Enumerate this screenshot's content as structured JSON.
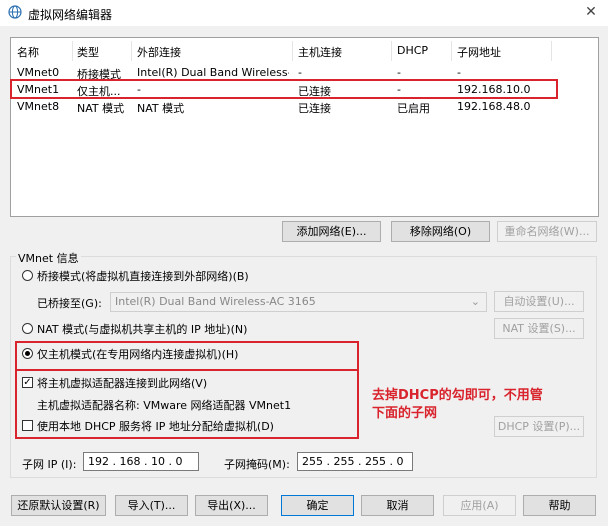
{
  "window": {
    "title": "虚拟网络编辑器",
    "close_glyph": "✕"
  },
  "table": {
    "headers": [
      "名称",
      "类型",
      "外部连接",
      "主机连接",
      "DHCP",
      "子网地址"
    ],
    "rows": [
      [
        "VMnet0",
        "桥接模式",
        "Intel(R) Dual Band Wireless-...",
        "-",
        "-",
        "-"
      ],
      [
        "VMnet1",
        "仅主机...",
        "-",
        "已连接",
        "-",
        "192.168.10.0"
      ],
      [
        "VMnet8",
        "NAT 模式",
        "NAT 模式",
        "已连接",
        "已启用",
        "192.168.48.0"
      ]
    ]
  },
  "table_buttons": {
    "add": "添加网络(E)...",
    "remove": "移除网络(O)",
    "rename": "重命名网络(W)..."
  },
  "vmnet_info": {
    "group_label": "VMnet 信息",
    "bridged_label": "桥接模式(将虚拟机直接连接到外部网络)(B)",
    "bridged_to_label": "已桥接至(G):",
    "bridged_to_value": "Intel(R) Dual Band Wireless-AC 3165",
    "auto_settings": "自动设置(U)...",
    "nat_label": "NAT 模式(与虚拟机共享主机的 IP 地址)(N)",
    "nat_settings": "NAT 设置(S)...",
    "hostonly_label": "仅主机模式(在专用网络内连接虚拟机)(H)",
    "connect_adapter_label": "将主机虚拟适配器连接到此网络(V)",
    "adapter_name_label": "主机虚拟适配器名称: VMware 网络适配器 VMnet1",
    "dhcp_label": "使用本地 DHCP 服务将 IP 地址分配给虚拟机(D)",
    "dhcp_settings": "DHCP 设置(P)...",
    "subnet_ip_label": "子网 IP (I):",
    "subnet_ip_value": "192 . 168 . 10 . 0",
    "subnet_mask_label": "子网掩码(M):",
    "subnet_mask_value": "255 . 255 . 255 . 0",
    "selected_mode": "host-only",
    "connect_adapter_checked": true,
    "dhcp_checked": false
  },
  "annotation": {
    "line1": "去掉DHCP的勾即可，不用管",
    "line2": "下面的子网",
    "color": "#d9232d"
  },
  "footer": {
    "restore": "还原默认设置(R)",
    "import": "导入(T)...",
    "export": "导出(X)...",
    "ok": "确定",
    "cancel": "取消",
    "apply": "应用(A)",
    "help": "帮助"
  }
}
